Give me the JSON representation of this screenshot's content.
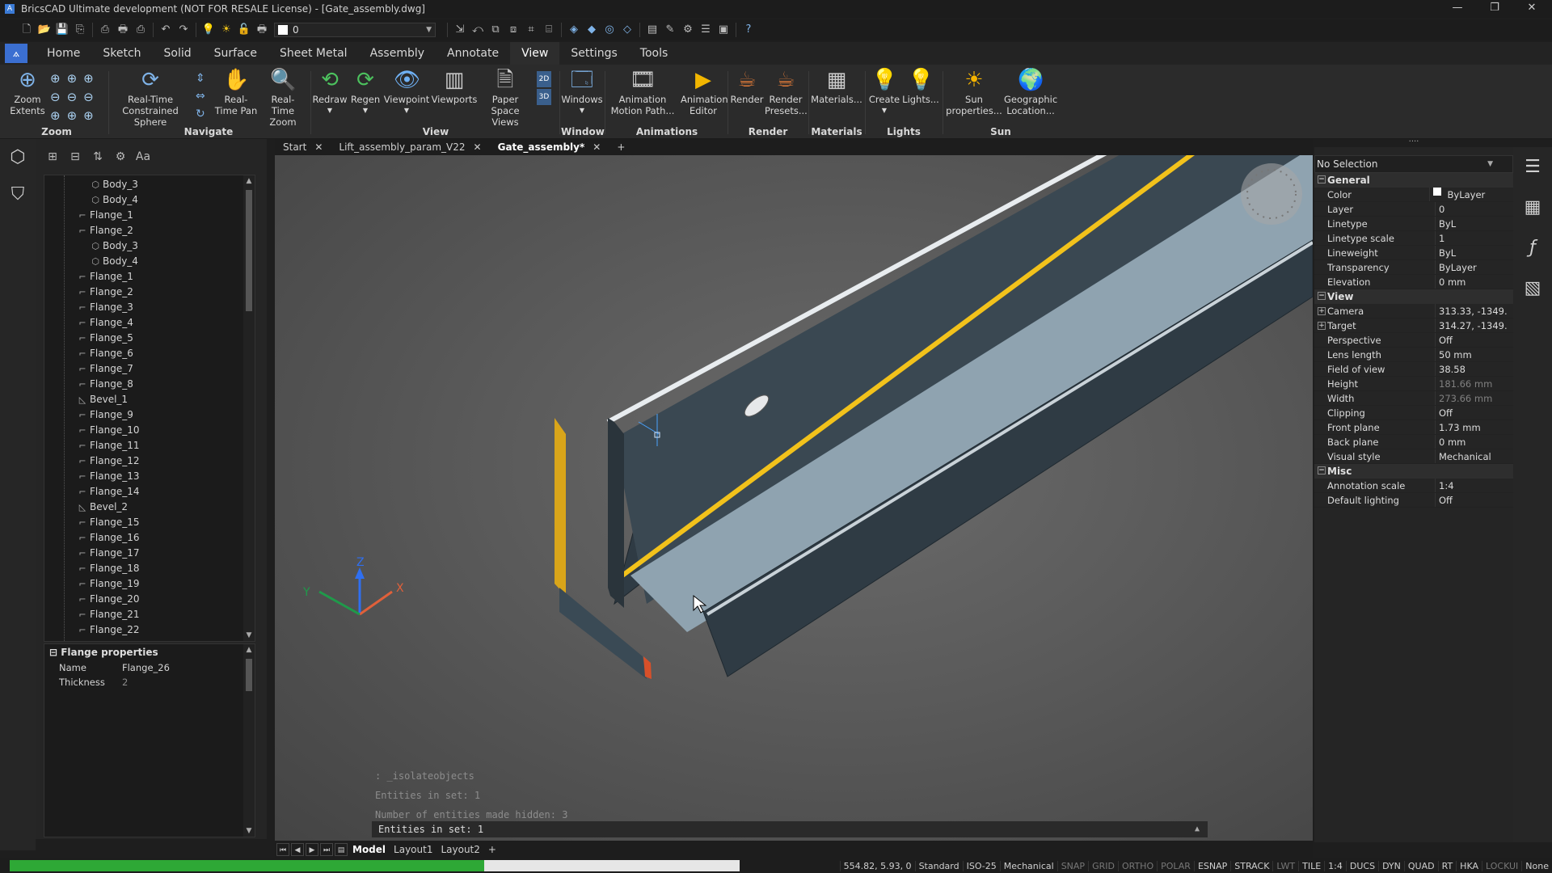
{
  "window": {
    "title": "BricsCAD Ultimate development (NOT FOR RESALE License) - [Gate_assembly.dwg]"
  },
  "qat": {
    "layer_value": "0"
  },
  "ribbon_tabs": [
    "Home",
    "Sketch",
    "Solid",
    "Surface",
    "Sheet Metal",
    "Assembly",
    "Annotate",
    "View",
    "Settings",
    "Tools"
  ],
  "ribbon": {
    "zoom": {
      "label": "Zoom",
      "extents": "Zoom Extents"
    },
    "navigate": {
      "label": "Navigate",
      "constrained": "Real-Time Constrained Sphere",
      "pan": "Real-Time Pan",
      "zoom": "Real-Time Zoom"
    },
    "view": {
      "label": "View",
      "redraw": "Redraw",
      "regen": "Regen",
      "viewpoint": "Viewpoint",
      "viewports": "Viewports",
      "paperspace": "Paper Space Views",
      "b2d": "2D",
      "b3d": "3D"
    },
    "window": {
      "label": "Window",
      "windows": "Windows"
    },
    "animations": {
      "label": "Animations",
      "motion": "Animation Motion Path...",
      "editor": "Animation Editor"
    },
    "render": {
      "label": "Render",
      "render": "Render",
      "presets": "Render Presets..."
    },
    "materials": {
      "label": "Materials",
      "materials": "Materials..."
    },
    "lights": {
      "label": "Lights",
      "create": "Create",
      "lights": "Lights..."
    },
    "sun": {
      "label": "Sun",
      "sunprops": "Sun properties...",
      "geo": "Geographic Location..."
    }
  },
  "tree": {
    "items": [
      {
        "label": "Body_3",
        "icon": "solid-body-icon",
        "level": 2
      },
      {
        "label": "Body_4",
        "icon": "solid-body-icon",
        "level": 2
      },
      {
        "label": "Flange_1",
        "icon": "flange-icon",
        "level": 1
      },
      {
        "label": "Flange_2",
        "icon": "flange-icon",
        "level": 1
      },
      {
        "label": "Body_3",
        "icon": "solid-body-icon",
        "level": 2
      },
      {
        "label": "Body_4",
        "icon": "solid-body-icon",
        "level": 2
      },
      {
        "label": "Flange_1",
        "icon": "flange-icon",
        "level": 1
      },
      {
        "label": "Flange_2",
        "icon": "flange-icon",
        "level": 1
      },
      {
        "label": "Flange_3",
        "icon": "flange-icon",
        "level": 1
      },
      {
        "label": "Flange_4",
        "icon": "flange-icon",
        "level": 1
      },
      {
        "label": "Flange_5",
        "icon": "flange-icon",
        "level": 1
      },
      {
        "label": "Flange_6",
        "icon": "flange-icon",
        "level": 1
      },
      {
        "label": "Flange_7",
        "icon": "flange-icon",
        "level": 1
      },
      {
        "label": "Flange_8",
        "icon": "flange-icon",
        "level": 1
      },
      {
        "label": "Bevel_1",
        "icon": "bevel-icon",
        "level": 1
      },
      {
        "label": "Flange_9",
        "icon": "flange-icon",
        "level": 1
      },
      {
        "label": "Flange_10",
        "icon": "flange-icon",
        "level": 1
      },
      {
        "label": "Flange_11",
        "icon": "flange-icon",
        "level": 1
      },
      {
        "label": "Flange_12",
        "icon": "flange-icon",
        "level": 1
      },
      {
        "label": "Flange_13",
        "icon": "flange-icon",
        "level": 1
      },
      {
        "label": "Flange_14",
        "icon": "flange-icon",
        "level": 1
      },
      {
        "label": "Bevel_2",
        "icon": "bevel-icon",
        "level": 1
      },
      {
        "label": "Flange_15",
        "icon": "flange-icon",
        "level": 1
      },
      {
        "label": "Flange_16",
        "icon": "flange-icon",
        "level": 1
      },
      {
        "label": "Flange_17",
        "icon": "flange-icon",
        "level": 1
      },
      {
        "label": "Flange_18",
        "icon": "flange-icon",
        "level": 1
      },
      {
        "label": "Flange_19",
        "icon": "flange-icon",
        "level": 1
      },
      {
        "label": "Flange_20",
        "icon": "flange-icon",
        "level": 1
      },
      {
        "label": "Flange_21",
        "icon": "flange-icon",
        "level": 1
      },
      {
        "label": "Flange_22",
        "icon": "flange-icon",
        "level": 1
      }
    ]
  },
  "flange_props": {
    "title": "Flange properties",
    "name_key": "Name",
    "name_val": "Flange_26",
    "thick_key": "Thickness",
    "thick_val": "2"
  },
  "doc_tabs": [
    "Start",
    "Lift_assembly_param_V22",
    "Gate_assembly*"
  ],
  "command_history": [
    ": _isolateobjects",
    "Entities in set: 1",
    "Number of entities made hidden: 3"
  ],
  "command_line": "Entities in set: 1",
  "layout_tabs": [
    "Model",
    "Layout1",
    "Layout2"
  ],
  "properties": {
    "selection": "No Selection",
    "general": {
      "title": "General",
      "rows": [
        {
          "k": "Color",
          "v": "ByLayer"
        },
        {
          "k": "Layer",
          "v": "0"
        },
        {
          "k": "Linetype",
          "v": "ByL"
        },
        {
          "k": "Linetype scale",
          "v": "1"
        },
        {
          "k": "Lineweight",
          "v": "ByL"
        },
        {
          "k": "Transparency",
          "v": "ByLayer"
        },
        {
          "k": "Elevation",
          "v": "0 mm"
        }
      ]
    },
    "view": {
      "title": "View",
      "rows": [
        {
          "k": "Camera",
          "v": "313.33, -1349.",
          "expand": true
        },
        {
          "k": "Target",
          "v": "314.27, -1349.",
          "expand": true
        },
        {
          "k": "Perspective",
          "v": "Off"
        },
        {
          "k": "Lens length",
          "v": "50 mm"
        },
        {
          "k": "Field of view",
          "v": "38.58"
        },
        {
          "k": "Height",
          "v": "181.66 mm",
          "dim": true
        },
        {
          "k": "Width",
          "v": "273.66 mm",
          "dim": true
        },
        {
          "k": "Clipping",
          "v": "Off"
        },
        {
          "k": "Front plane",
          "v": "1.73 mm"
        },
        {
          "k": "Back plane",
          "v": "0 mm"
        },
        {
          "k": "Visual style",
          "v": "Mechanical"
        }
      ]
    },
    "misc": {
      "title": "Misc",
      "rows": [
        {
          "k": "Annotation scale",
          "v": "1:4"
        },
        {
          "k": "Default lighting",
          "v": "Off"
        }
      ]
    }
  },
  "status": {
    "progress": 0.65,
    "coords": "554.82, 5.93, 0",
    "items": [
      {
        "t": "Standard",
        "on": true
      },
      {
        "t": "ISO-25",
        "on": true
      },
      {
        "t": "Mechanical",
        "on": true
      },
      {
        "t": "SNAP",
        "on": false
      },
      {
        "t": "GRID",
        "on": false
      },
      {
        "t": "ORTHO",
        "on": false
      },
      {
        "t": "POLAR",
        "on": false
      },
      {
        "t": "ESNAP",
        "on": true
      },
      {
        "t": "STRACK",
        "on": true
      },
      {
        "t": "LWT",
        "on": false
      },
      {
        "t": "TILE",
        "on": true
      },
      {
        "t": "1:4",
        "on": true
      },
      {
        "t": "DUCS",
        "on": true
      },
      {
        "t": "DYN",
        "on": true
      },
      {
        "t": "QUAD",
        "on": true
      },
      {
        "t": "RT",
        "on": true
      },
      {
        "t": "HKA",
        "on": true
      },
      {
        "t": "LOCKUI",
        "on": false
      },
      {
        "t": "None",
        "on": true
      }
    ]
  },
  "colors": {
    "accent": "#3b6fd1",
    "progress": "#2ea836",
    "edge_highlight": "#f2c21b",
    "part_face": "#8fa3b0",
    "part_dark": "#2f3b44"
  }
}
